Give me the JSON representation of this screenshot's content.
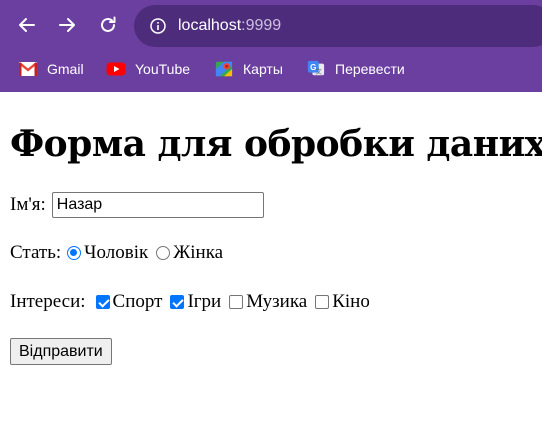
{
  "browser": {
    "url_host": "localhost",
    "url_port": ":9999",
    "bookmarks": [
      {
        "label": "Gmail",
        "icon": "gmail-icon"
      },
      {
        "label": "YouTube",
        "icon": "youtube-icon"
      },
      {
        "label": "Карты",
        "icon": "maps-icon"
      },
      {
        "label": "Перевести",
        "icon": "translate-icon"
      }
    ],
    "colors": {
      "toolbar": "#6b3fa0",
      "omnibox": "#4e2c7c"
    }
  },
  "page": {
    "title": "Форма для обробки даних",
    "name_label": "Ім'я:",
    "name_value": "Назар",
    "gender_label": "Стать:",
    "gender_options": [
      {
        "label": "Чоловік",
        "checked": true
      },
      {
        "label": "Жінка",
        "checked": false
      }
    ],
    "interests_label": "Інтереси:",
    "interests": [
      {
        "label": "Спорт",
        "checked": true
      },
      {
        "label": "Ігри",
        "checked": true
      },
      {
        "label": "Музика",
        "checked": false
      },
      {
        "label": "Кіно",
        "checked": false
      }
    ],
    "submit_label": "Відправити",
    "accent_color": "#0075ff"
  }
}
